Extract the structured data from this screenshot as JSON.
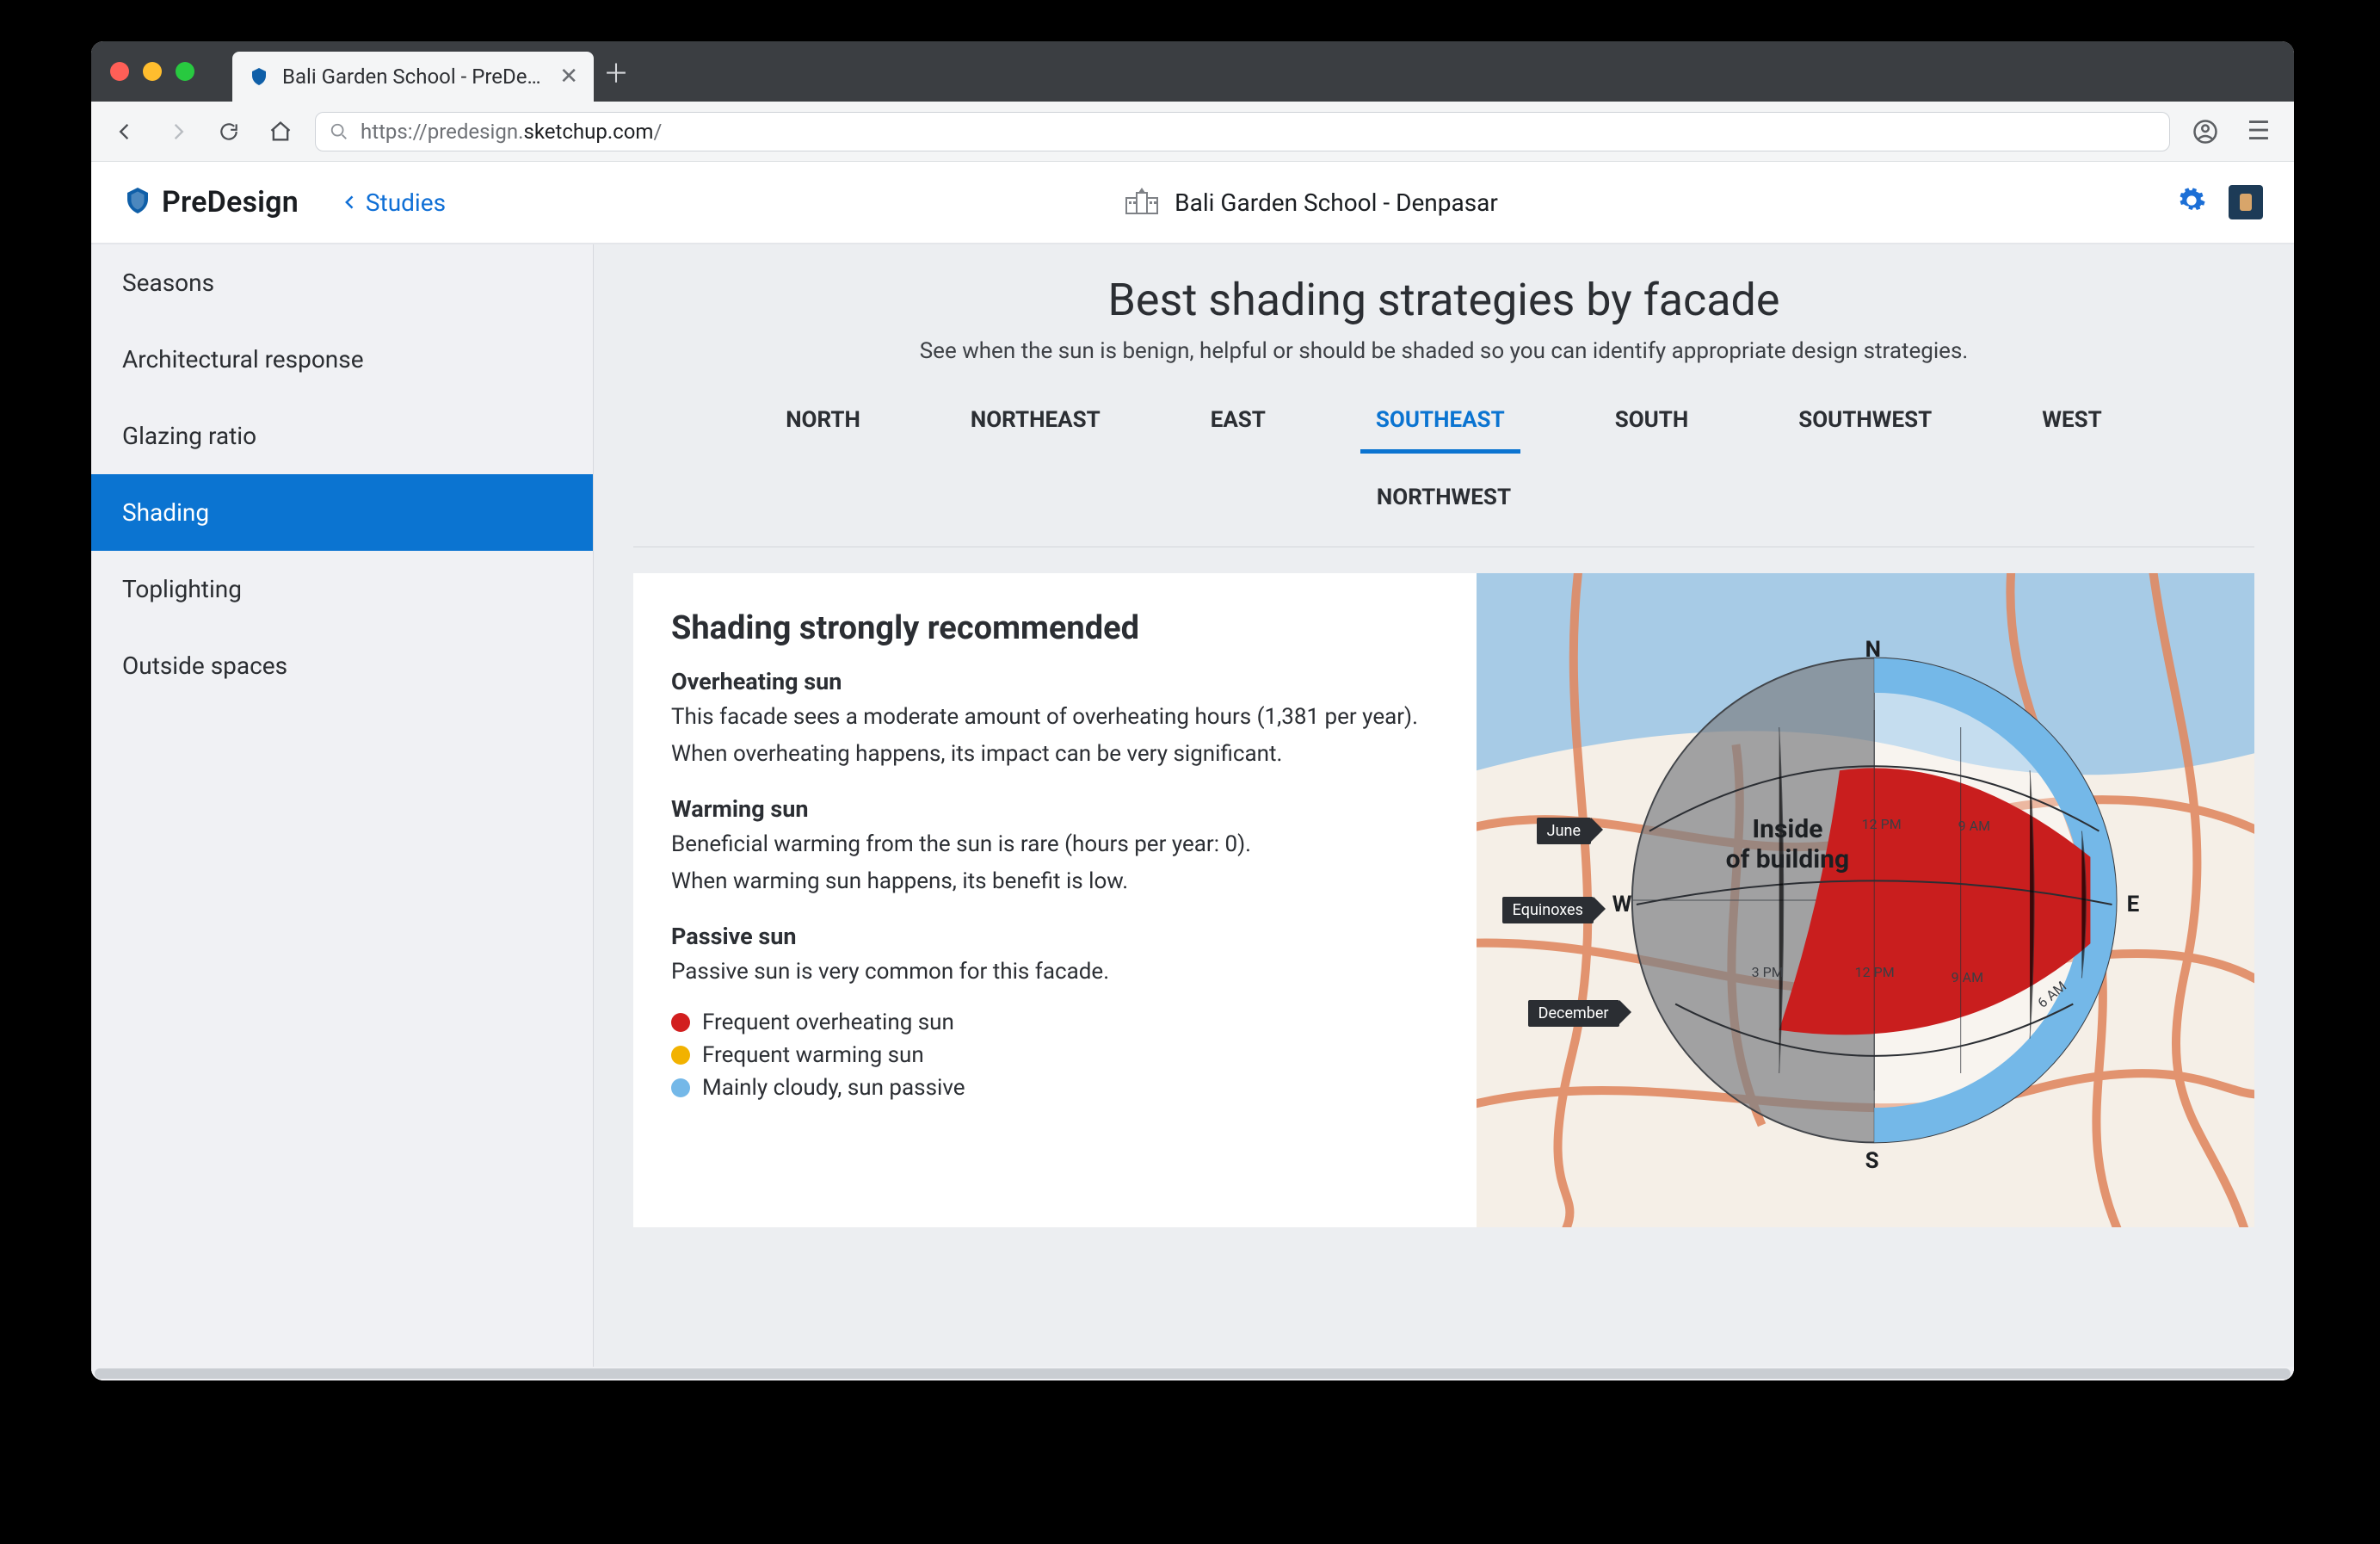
{
  "browser": {
    "tab_title": "Bali Garden School - PreDesign",
    "url_display_prefix": "https://predesign.",
    "url_display_domain": "sketchup.com",
    "url_display_suffix": "/"
  },
  "header": {
    "brand": "PreDesign",
    "backlink": "Studies",
    "project": "Bali Garden School - Denpasar"
  },
  "sidebar": {
    "items": [
      {
        "label": "Seasons"
      },
      {
        "label": "Architectural response"
      },
      {
        "label": "Glazing ratio"
      },
      {
        "label": "Shading"
      },
      {
        "label": "Toplighting"
      },
      {
        "label": "Outside spaces"
      }
    ],
    "active_index": 3
  },
  "page": {
    "title": "Best shading strategies by facade",
    "description": "See when the sun is benign, helpful or should be shaded so you can identify appropriate design strategies."
  },
  "facade_tabs": {
    "row1": [
      "NORTH",
      "NORTHEAST",
      "EAST",
      "SOUTHEAST",
      "SOUTH",
      "SOUTHWEST",
      "WEST"
    ],
    "row2": [
      "NORTHWEST"
    ],
    "active": "SOUTHEAST"
  },
  "card": {
    "heading": "Shading strongly recommended",
    "s1_title": "Overheating sun",
    "s1_p1": "This facade sees a moderate amount of overheating hours (1,381 per year).",
    "s1_p2": "When overheating happens, its impact can be very significant.",
    "s2_title": "Warming sun",
    "s2_p1": "Beneficial warming from the sun is rare (hours per year: 0).",
    "s2_p2": "When warming sun happens, its benefit is low.",
    "s3_title": "Passive sun",
    "s3_p1": "Passive sun is very common for this facade.",
    "legend": [
      {
        "color": "#d21f1f",
        "label": "Frequent overheating sun"
      },
      {
        "color": "#f2b200",
        "label": "Frequent warming sun"
      },
      {
        "color": "#74b8e8",
        "label": "Mainly cloudy, sun passive"
      }
    ]
  },
  "diagram": {
    "period_labels": {
      "june": "June",
      "equinoxes": "Equinoxes",
      "december": "December"
    },
    "inside_line1": "Inside",
    "inside_line2": "of building",
    "compass": {
      "n": "N",
      "e": "E",
      "s": "S",
      "w": "W"
    },
    "times": {
      "t12": "12 PM",
      "t9": "9 AM",
      "t3": "3 PM",
      "t6": "6 AM",
      "t_extra12": "12 PM",
      "t_extra9": "9 AM"
    }
  },
  "chart_data": {
    "type": "sunpath-facade",
    "facade": "SOUTHEAST",
    "location": "Bali Garden School - Denpasar",
    "overheating_hours_per_year": 1381,
    "warming_hours_per_year": 0,
    "compass_orientation": [
      "N",
      "E",
      "S",
      "W"
    ],
    "season_arcs": [
      "June",
      "Equinoxes",
      "December"
    ],
    "hour_ticks_visible": [
      "6 AM",
      "9 AM",
      "12 PM",
      "3 PM"
    ],
    "legend": [
      {
        "name": "Frequent overheating sun",
        "color": "#d21f1f"
      },
      {
        "name": "Frequent warming sun",
        "color": "#f2b200"
      },
      {
        "name": "Mainly cloudy, sun passive",
        "color": "#74b8e8"
      }
    ],
    "dominant_region_on_facade_side": "Frequent overheating sun"
  }
}
